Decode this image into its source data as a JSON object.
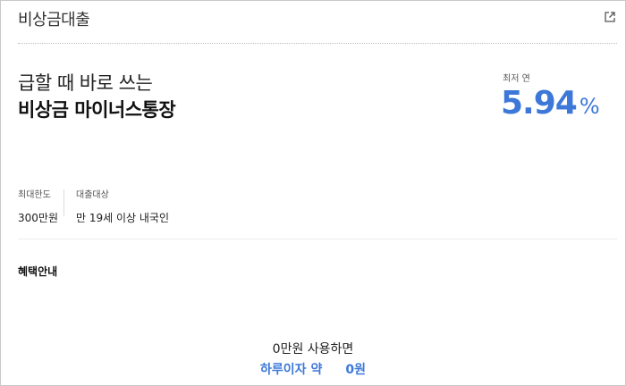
{
  "header": {
    "title": "비상금대출",
    "share_icon": "share-external-icon"
  },
  "headline": {
    "line1": "급할 때 바로 쓰는",
    "line2": "비상금 마이너스통장"
  },
  "rate": {
    "label": "최저 연",
    "value": "5.94",
    "unit": "%",
    "color": "#3d78d8"
  },
  "info": [
    {
      "label": "최대한도",
      "value": "300만원"
    },
    {
      "label": "대출대상",
      "value": "만 19세 이상 내국인"
    }
  ],
  "benefit": {
    "title": "혜택안내",
    "usage_text": "0만원 사용하면",
    "interest_label": "하루이자 약",
    "interest_value": "0원"
  }
}
